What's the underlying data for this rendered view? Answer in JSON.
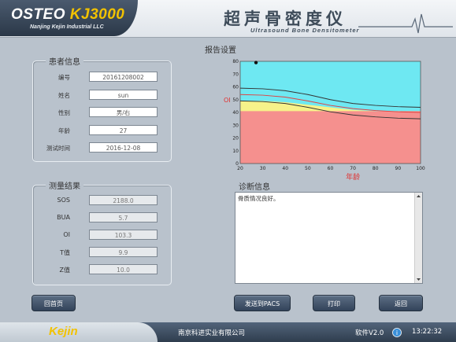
{
  "header": {
    "logo_main": "OSTEO",
    "logo_model": "KJ3000",
    "logo_sub": "Nanjing Kejin Industrial LLC",
    "title_cn": "超声骨密度仪",
    "title_en": "Ultrasound Bone Densitometer"
  },
  "patient": {
    "title": "患者信息",
    "fields": [
      {
        "label": "编号",
        "value": "20161208002"
      },
      {
        "label": "姓名",
        "value": "sun"
      },
      {
        "label": "性别",
        "value": "男/右"
      },
      {
        "label": "年龄",
        "value": "27"
      },
      {
        "label": "测试时间",
        "value": "2016-12-08"
      }
    ]
  },
  "results": {
    "title": "测量结果",
    "fields": [
      {
        "label": "SOS",
        "value": "2188.0"
      },
      {
        "label": "BUA",
        "value": "5.7"
      },
      {
        "label": "OI",
        "value": "103.3"
      },
      {
        "label": "T值",
        "value": "9.9"
      },
      {
        "label": "Z值",
        "value": "10.0"
      }
    ]
  },
  "report": {
    "title": "报告设置"
  },
  "diagnosis": {
    "title": "诊断信息",
    "text": "骨质情况良好。"
  },
  "buttons": {
    "home": "回首页",
    "send_pacs": "发送到PACS",
    "print": "打印",
    "back": "返回"
  },
  "footer": {
    "brand": "Kejin",
    "company": "南京科进实业有限公司",
    "version": "软件V2.0",
    "time": "13:22:32"
  },
  "chart_data": {
    "type": "area",
    "xlabel": "年龄",
    "ylabel": "OI",
    "xlim": [
      20,
      100
    ],
    "ylim": [
      0,
      80
    ],
    "x_ticks": [
      20,
      30,
      40,
      50,
      60,
      70,
      80,
      90,
      100
    ],
    "y_ticks": [
      0,
      10,
      20,
      30,
      40,
      50,
      60,
      70,
      80
    ],
    "bands": [
      {
        "name": "low",
        "color": "#f5908e",
        "upper_x": [
          20,
          30,
          40,
          50,
          60,
          70,
          80,
          90,
          100
        ],
        "upper_y": [
          41,
          41,
          41,
          41,
          41,
          41,
          41,
          41,
          41
        ]
      },
      {
        "name": "mid",
        "color": "#f7f28a",
        "upper_x": [
          20,
          30,
          40,
          50,
          60,
          70,
          80,
          90,
          100
        ],
        "upper_y": [
          49,
          49,
          48,
          46,
          44,
          42,
          41,
          41,
          41
        ]
      },
      {
        "name": "high",
        "color": "#6ee8f2",
        "upper_x": [
          20,
          100
        ],
        "upper_y": [
          80,
          80
        ]
      }
    ],
    "series": [
      {
        "color": "#333333",
        "x": [
          20,
          30,
          40,
          50,
          60,
          70,
          80,
          90,
          100
        ],
        "y": [
          59,
          58.5,
          57,
          54,
          50,
          47,
          45.5,
          44.5,
          44
        ]
      },
      {
        "color": "#e04040",
        "x": [
          20,
          30,
          40,
          50,
          60,
          70,
          80,
          90,
          100
        ],
        "y": [
          54,
          53.5,
          52,
          49,
          45.5,
          43,
          41.5,
          40.5,
          40
        ]
      },
      {
        "color": "#333333",
        "x": [
          20,
          30,
          40,
          50,
          60,
          70,
          80,
          90,
          100
        ],
        "y": [
          49,
          48.5,
          47,
          44,
          40.5,
          38,
          36.5,
          35.5,
          35
        ]
      }
    ],
    "point": {
      "x": 27,
      "y": 79
    }
  }
}
